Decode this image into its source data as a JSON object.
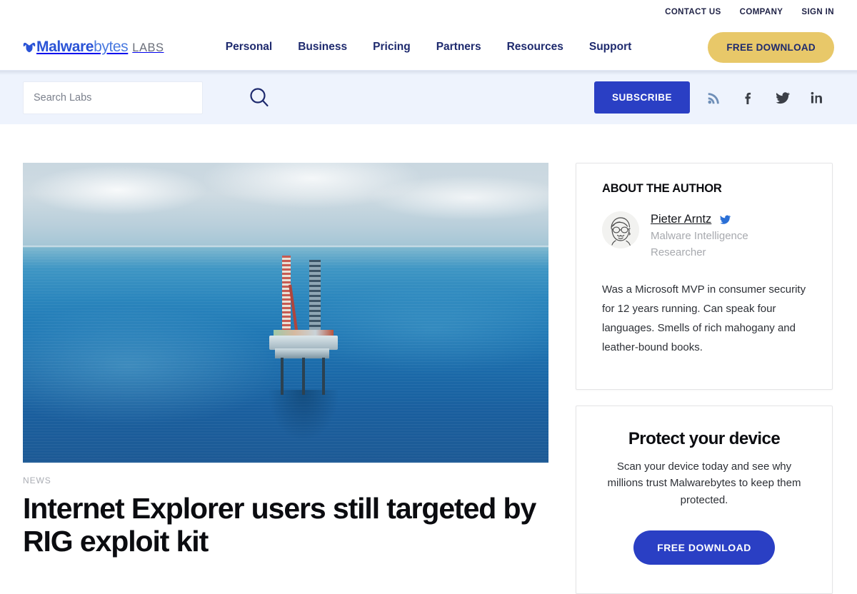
{
  "utility_bar": {
    "links": [
      {
        "label": "CONTACT US",
        "name": "contact-us"
      },
      {
        "label": "COMPANY",
        "name": "company"
      },
      {
        "label": "SIGN IN",
        "name": "sign-in"
      }
    ]
  },
  "header": {
    "logo": {
      "part1": "Malware",
      "part2": "bytes",
      "part3": "LABS",
      "icon": "malwarebytes-m-icon"
    },
    "nav": [
      {
        "label": "Personal"
      },
      {
        "label": "Business"
      },
      {
        "label": "Pricing"
      },
      {
        "label": "Partners"
      },
      {
        "label": "Resources"
      },
      {
        "label": "Support"
      }
    ],
    "cta_label": "FREE DOWNLOAD",
    "cta_color": "#e8c869",
    "cta_text_color": "#1e2a6e",
    "nav_color": "#1e2a6e"
  },
  "search_strip": {
    "search_placeholder": "Search Labs",
    "search_value": "",
    "search_icon": "search-icon",
    "subscribe_label": "SUBSCRIBE",
    "subscribe_color": "#2a3fc4",
    "background": "#eef3fd",
    "social": [
      {
        "name": "rss-icon",
        "label": "RSS",
        "color": "#6f8fb8"
      },
      {
        "name": "facebook-icon",
        "label": "Facebook",
        "color": "#3b3f47"
      },
      {
        "name": "twitter-icon",
        "label": "Twitter",
        "color": "#3b3f47"
      },
      {
        "name": "linkedin-icon",
        "label": "LinkedIn",
        "color": "#3b3f47"
      }
    ]
  },
  "article": {
    "hero_alt": "Offshore oil drilling rig platform alone in the open blue ocean",
    "category": "NEWS",
    "title": "Internet Explorer users still targeted by RIG exploit kit"
  },
  "sidebar": {
    "author_card": {
      "heading": "ABOUT THE AUTHOR",
      "avatar_alt": "Sketch portrait of a man with glasses and a moustache",
      "name": "Pieter Arntz",
      "twitter_icon": "twitter-icon",
      "role": "Malware Intelligence Researcher",
      "bio": "Was a Microsoft MVP in consumer security for 12 years running. Can speak four languages. Smells of rich mahogany and leather-bound books."
    },
    "promo_card": {
      "title": "Protect your device",
      "text": "Scan your device today and see why millions trust Malwarebytes to keep them protected.",
      "cta_label": "FREE DOWNLOAD",
      "cta_color": "#2a3fc4"
    }
  }
}
